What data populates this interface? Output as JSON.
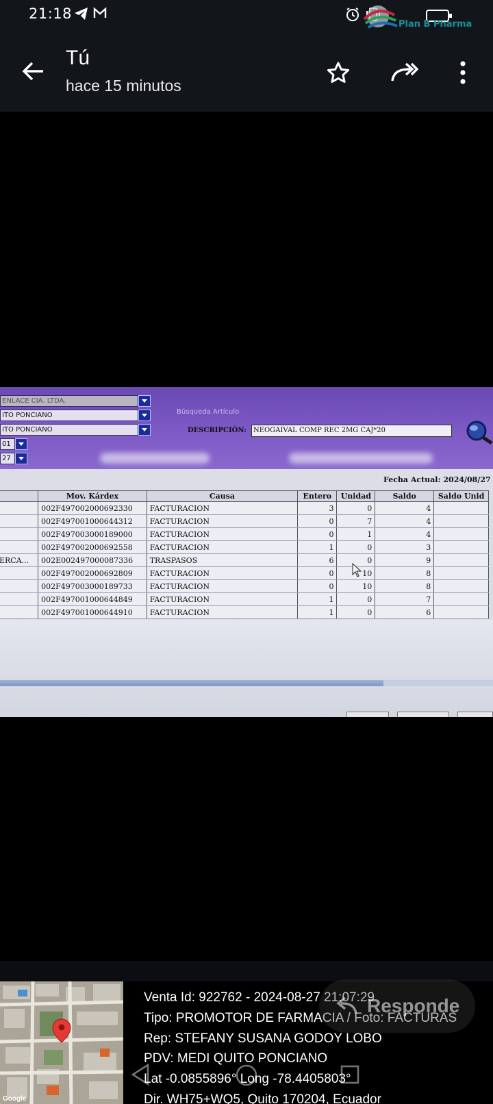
{
  "status_bar": {
    "time": "21:18",
    "icons": [
      "telegram-icon",
      "gmail-icon",
      "alarm-icon",
      "vibrate-icon",
      "battery-icon"
    ],
    "overlay_logo_text": "Plan B Pharma"
  },
  "app_bar": {
    "sender": "Tú",
    "time_ago": "hace 15 minutos",
    "icons": [
      "back-arrow-icon",
      "star-icon",
      "forward-icon",
      "more-vert-icon"
    ]
  },
  "photo": {
    "combos": [
      "ENLACE CIA. LTDA.",
      "ITO PONCIANO",
      "ITO PONCIANO",
      "01",
      "27"
    ],
    "search_caption": "Búsqueda Artículo",
    "description_label": "DESCRIPCIÓN:",
    "description_value": "NEOGAIVAL COMP REC 2MG CAJ*20",
    "fecha_label": "Fecha Actual:",
    "fecha_value": "2024/08/27",
    "table": {
      "columns": [
        "",
        "Mov. Kárdex",
        "Causa",
        "Entero",
        "Unidad",
        "Saldo",
        "Saldo Unid"
      ],
      "rows": [
        [
          "",
          "002F497002000692330",
          "FACTURACION",
          "3",
          "0",
          "4",
          ""
        ],
        [
          "",
          "002F497001000644312",
          "FACTURACION",
          "0",
          "7",
          "4",
          ""
        ],
        [
          "",
          "002F497003000189000",
          "FACTURACION",
          "0",
          "1",
          "4",
          ""
        ],
        [
          "",
          "002F497002000692558",
          "FACTURACION",
          "1",
          "0",
          "3",
          ""
        ],
        [
          "ERCA...",
          "002E002497000087336",
          "TRASPASOS",
          "6",
          "0",
          "9",
          ""
        ],
        [
          "",
          "002F497002000692809",
          "FACTURACION",
          "0",
          "10",
          "8",
          ""
        ],
        [
          "",
          "002F497003000189733",
          "FACTURACION",
          "0",
          "10",
          "8",
          ""
        ],
        [
          "",
          "002F497001000644849",
          "FACTURACION",
          "1",
          "0",
          "7",
          ""
        ],
        [
          "",
          "002F497001000644910",
          "FACTURACION",
          "1",
          "0",
          "6",
          ""
        ]
      ]
    }
  },
  "info": {
    "line1": "Venta Id: 922762 - 2024-08-27 21:07:29",
    "line2": "Tipo: PROMOTOR DE FARMACIA / Foto: FACTURAS",
    "line3": "Rep: STEFANY SUSANA GODOY LOBO",
    "line4": "PDV: MEDI QUITO PONCIANO",
    "line5": "Lat -0.0855896° Long -78.4405803°",
    "line6": "Dir. WH75+WQ5, Quito 170204, Ecuador",
    "map_attribution": "Google",
    "reply_label": "Responde"
  },
  "colors": {
    "bar_bg": "#12161b",
    "app_purple": "#7a57c2",
    "map_pin": "#e53935"
  }
}
